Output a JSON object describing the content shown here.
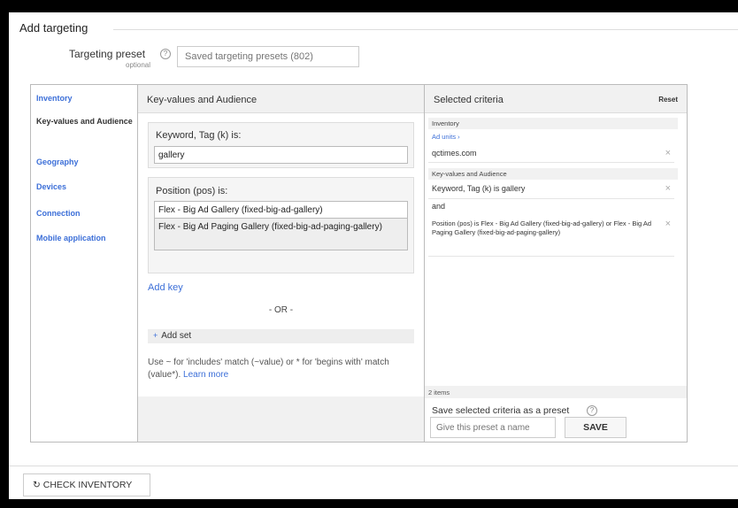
{
  "header": {
    "title": "Add targeting",
    "preset_label": "Targeting preset",
    "preset_optional": "optional",
    "preset_help": "?",
    "preset_placeholder": "Saved targeting presets (802)"
  },
  "nav": {
    "items": [
      {
        "label": "Inventory"
      },
      {
        "label": "Key-values and Audience"
      },
      {
        "label": "Geography"
      },
      {
        "label": "Devices"
      },
      {
        "label": "Connection"
      },
      {
        "label": "Mobile application"
      }
    ]
  },
  "middle": {
    "heading": "Key-values and Audience",
    "keyword_label": "Keyword, Tag (k) is:",
    "keyword_value": "gallery",
    "position_label": "Position (pos) is:",
    "position_values": [
      "Flex - Big Ad Gallery (fixed-big-ad-gallery)",
      "Flex - Big Ad Paging Gallery (fixed-big-ad-paging-gallery)"
    ],
    "add_key": "Add key",
    "or": "- OR -",
    "add_set_icon": "+",
    "add_set": "Add set",
    "hint": "Use ~ for 'includes' match (~value) or * for 'begins with' match (value*).",
    "learn_more": "Learn more"
  },
  "right": {
    "heading": "Selected criteria",
    "reset": "Reset",
    "inventory_header": "Inventory",
    "ad_units_label": "Ad units ›",
    "ad_unit_value": "qctimes.com",
    "kv_header": "Key-values and Audience",
    "kv_row1": "Keyword, Tag (k) is gallery",
    "kv_and": "and",
    "kv_row2": "Position (pos) is Flex - Big Ad Gallery (fixed-big-ad-gallery) or Flex - Big Ad Paging Gallery (fixed-big-ad-paging-gallery)",
    "remove": "×",
    "items_count": "2 items",
    "save_label": "Save selected criteria as a preset",
    "save_help": "?",
    "save_placeholder": "Give this preset a name",
    "save_button": "SAVE"
  },
  "footer": {
    "check_inventory_icon": "↻",
    "check_inventory": "CHECK INVENTORY"
  }
}
